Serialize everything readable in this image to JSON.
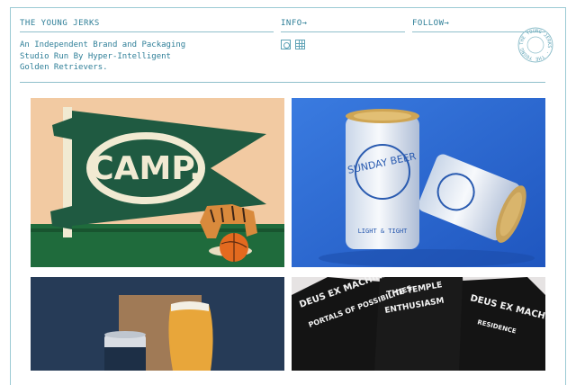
{
  "header": {
    "brand": "THE YOUNG JERKS",
    "info_label": "INFO→",
    "follow_label": "FOLLOW→",
    "tagline": "An Independent Brand and Packaging Studio Run By Hyper-Intelligent Golden Retrievers.",
    "social_icons": [
      "instagram-icon",
      "grid-icon"
    ],
    "seal_text": "THE YOUNG JERKS"
  },
  "gallery": {
    "tiles": [
      {
        "name": "camp-pennant-project",
        "pennant_text": "CAMP."
      },
      {
        "name": "sunday-beer-project",
        "can_text": "SUNDAY BEER",
        "can_footer": "LIGHT & TIGHT"
      },
      {
        "name": "dark-beer-project"
      },
      {
        "name": "deus-ex-machina-shirts-project"
      }
    ]
  },
  "colors": {
    "accent": "#2f7f98",
    "rule": "#8fbfcb",
    "camp_bg": "#f0c9a0",
    "camp_pennant": "#1f5a41",
    "sunday_bg": "#2f6ed6"
  }
}
